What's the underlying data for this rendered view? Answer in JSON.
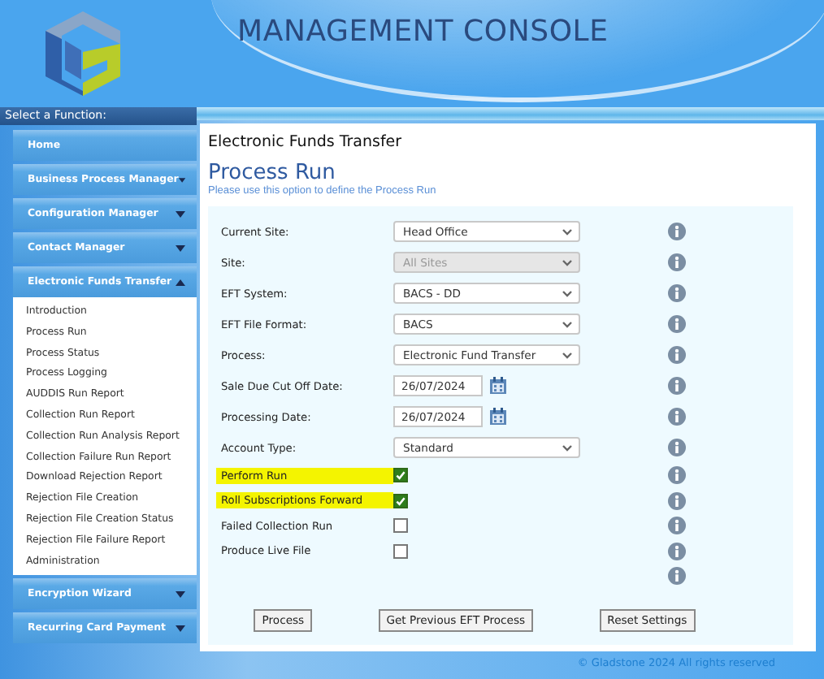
{
  "header": {
    "title": "MANAGEMENT CONSOLE"
  },
  "sidebar": {
    "heading": "Select a Function:",
    "items": [
      {
        "label": "Home",
        "kind": "link",
        "expanded": false
      },
      {
        "label": "Business Process Manager",
        "kind": "group",
        "expanded": false
      },
      {
        "label": "Configuration Manager",
        "kind": "group",
        "expanded": false
      },
      {
        "label": "Contact Manager",
        "kind": "group",
        "expanded": false
      },
      {
        "label": "Electronic Funds Transfer",
        "kind": "group",
        "expanded": true,
        "children": [
          {
            "label": "Introduction"
          },
          {
            "label": "Process Run"
          },
          {
            "label": "Process Status"
          },
          {
            "label": "Process Logging"
          },
          {
            "label": "AUDDIS Run Report"
          },
          {
            "label": "Collection Run Report"
          },
          {
            "label": "Collection Run Analysis Report"
          },
          {
            "label": "Collection Failure Run Report"
          },
          {
            "label": "Download Rejection Report"
          },
          {
            "label": "Rejection File Creation"
          },
          {
            "label": "Rejection File Creation Status"
          },
          {
            "label": "Rejection File Failure Report"
          },
          {
            "label": "Administration"
          }
        ]
      },
      {
        "label": "Encryption Wizard",
        "kind": "group",
        "expanded": false
      },
      {
        "label": "Recurring Card Payment",
        "kind": "group",
        "expanded": false
      }
    ]
  },
  "main": {
    "section_title": "Electronic Funds Transfer",
    "page_title": "Process Run",
    "description": "Please use this option to define the Process Run",
    "fields": [
      {
        "kind": "select",
        "label": "Current Site:",
        "value": "Head Office",
        "disabled": false
      },
      {
        "kind": "select",
        "label": "Site:",
        "value": "All Sites",
        "disabled": true
      },
      {
        "kind": "select",
        "label": "EFT System:",
        "value": "BACS - DD",
        "disabled": false
      },
      {
        "kind": "select",
        "label": "EFT File Format:",
        "value": "BACS",
        "disabled": false
      },
      {
        "kind": "select",
        "label": "Process:",
        "value": "Electronic Fund Transfer",
        "disabled": false
      },
      {
        "kind": "date",
        "label": "Sale Due Cut Off Date:",
        "value": "26/07/2024"
      },
      {
        "kind": "date",
        "label": "Processing Date:",
        "value": "26/07/2024"
      },
      {
        "kind": "select",
        "label": "Account Type:",
        "value": "Standard",
        "disabled": false
      },
      {
        "kind": "checkbox",
        "label": "Perform Run",
        "checked": true,
        "highlighted": true
      },
      {
        "kind": "checkbox",
        "label": "Roll Subscriptions Forward",
        "checked": true,
        "highlighted": true
      },
      {
        "kind": "checkbox",
        "label": "Failed Collection Run",
        "checked": false,
        "highlighted": false
      },
      {
        "kind": "checkbox",
        "label": "Produce Live File",
        "checked": false,
        "highlighted": false
      },
      {
        "kind": "info"
      }
    ],
    "buttons": [
      "Process",
      "Get Previous EFT Process",
      "Reset Settings"
    ],
    "footer": "© Gladstone 2024 All rights reserved"
  }
}
